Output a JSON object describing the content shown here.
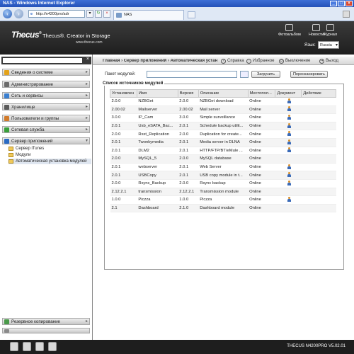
{
  "browser": {
    "title": "NAS - Windows Internet Explorer",
    "address": "http://n4200pro/adr",
    "tab_title": "NAS"
  },
  "header": {
    "logo": "Thecus",
    "slogan": "Thecus®. Creator in Storage",
    "site": "www.thecus.com",
    "icons": [
      {
        "name": "photo-album-icon",
        "label": "Фотоальбом"
      },
      {
        "name": "news-icon",
        "label": "Новости"
      },
      {
        "name": "log-icon",
        "label": "Журнал"
      }
    ],
    "language_label": "Язык:",
    "language_value": "Russia"
  },
  "sidebar": {
    "sections": [
      {
        "label": "Сведения о системе",
        "icon": "info-icon",
        "color": "#e3a21a"
      },
      {
        "label": "Администрирование",
        "icon": "tools-icon",
        "color": "#6b6b6b"
      },
      {
        "label": "Сеть и сервисы",
        "icon": "network-icon",
        "color": "#3a7fd0"
      },
      {
        "label": "Хранилище",
        "icon": "storage-icon",
        "color": "#5a5a5a"
      },
      {
        "label": "Пользователи и группы",
        "icon": "users-icon",
        "color": "#d17a2a"
      },
      {
        "label": "Сетевая служба",
        "icon": "service-icon",
        "color": "#3aa03a"
      },
      {
        "label": "Сервер приложений",
        "icon": "app-server-icon",
        "color": "#2a6bc4"
      }
    ],
    "subitems": [
      {
        "label": "Сервер iTunes"
      },
      {
        "label": "Модули"
      },
      {
        "label": "Автоматическая установка модулей"
      }
    ],
    "bottom_section": {
      "label": "Резервное копирование",
      "icon": "backup-icon",
      "color": "#4a9a4a"
    }
  },
  "main": {
    "breadcrumb": "Главная › Сервер приложений › Автоматическая установка модулей",
    "top_links": {
      "help": "Справка",
      "favorites": "Избранное",
      "shutdown": "Выключение",
      "logout": "Выход"
    },
    "package_label": "Пакет модулей:",
    "install_button": "Загрузить",
    "rescan_button": "Пересканировать",
    "list_title": "Список источников модулей",
    "columns": [
      "Установлен",
      "Имя",
      "Версия",
      "Описание",
      "Местопол...",
      "Документ",
      "Действие"
    ],
    "rows": [
      {
        "installed": "2.0.0",
        "name": "NZBGet",
        "version": "2.0.0",
        "description": "NZBGet download",
        "location": "Online",
        "doc": true
      },
      {
        "installed": "2.00.02",
        "name": "Mailserver",
        "version": "2.00.02",
        "description": "Mail server",
        "location": "Online",
        "doc": true
      },
      {
        "installed": "3.0.0",
        "name": "IP_Cam",
        "version": "3.0.0",
        "description": "Simple surveillance",
        "location": "Online",
        "doc": true
      },
      {
        "installed": "2.0.1",
        "name": "Usb_eSATA_Bac...",
        "version": "2.0.1",
        "description": "Schedule backup utilit...",
        "location": "Online",
        "doc": true
      },
      {
        "installed": "2.0.0",
        "name": "Rsst_Replication",
        "version": "2.0.0",
        "description": "Duplication for create...",
        "location": "Online",
        "doc": true
      },
      {
        "installed": "2.0.1",
        "name": "Twonkymedia",
        "version": "2.0.1",
        "description": "Media server in DLNA",
        "location": "Online",
        "doc": true
      },
      {
        "installed": "2.0.1",
        "name": "DLM2",
        "version": "2.0.1",
        "description": "HTTP/FTP/BT/eMule ...",
        "location": "Online",
        "doc": true
      },
      {
        "installed": "2.0.0",
        "name": "MySQL_5",
        "version": "2.0.0",
        "description": "MySQL database",
        "location": "Online",
        "doc": false
      },
      {
        "installed": "2.0.1",
        "name": "webserver",
        "version": "2.0.1",
        "description": "Web Server",
        "location": "Online",
        "doc": true
      },
      {
        "installed": "2.0.1",
        "name": "USBCopy",
        "version": "2.0.1",
        "description": "USB copy module in t...",
        "location": "Online",
        "doc": true
      },
      {
        "installed": "2.0.0",
        "name": "Rsync_Backup",
        "version": "2.0.0",
        "description": "Rsync backup",
        "location": "Online",
        "doc": true
      },
      {
        "installed": "2.12.2.1",
        "name": "transmission",
        "version": "2.12.2.1",
        "description": "Transmission module",
        "location": "Online",
        "doc": false
      },
      {
        "installed": "1.0.0",
        "name": "Piczza",
        "version": "1.0.0",
        "description": "Piczza",
        "location": "Online",
        "doc": true
      },
      {
        "installed": "2.1",
        "name": "Dashboard",
        "version": "2.1.0",
        "description": "Dashboard module",
        "location": "Online",
        "doc": false
      }
    ]
  },
  "footer": {
    "icons": [
      "home-icon",
      "disk-icon",
      "printer-icon",
      "network-status-icon"
    ],
    "version": "THECUS N4200PRO V5.02.01"
  }
}
